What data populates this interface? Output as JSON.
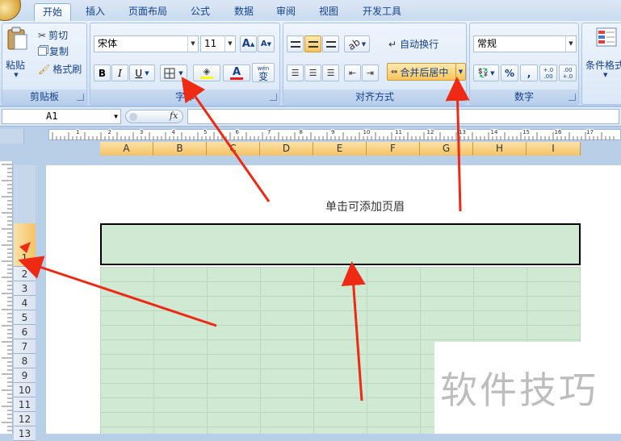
{
  "tabs": [
    {
      "label": "开始"
    },
    {
      "label": "插入"
    },
    {
      "label": "页面布局"
    },
    {
      "label": "公式"
    },
    {
      "label": "数据"
    },
    {
      "label": "审阅"
    },
    {
      "label": "视图"
    },
    {
      "label": "开发工具"
    }
  ],
  "clipboard": {
    "paste": "粘贴",
    "cut": "剪切",
    "copy": "复制",
    "format_painter": "格式刷",
    "label": "剪贴板"
  },
  "font": {
    "name": "宋体",
    "size": "11",
    "grow": "A",
    "shrink": "A",
    "bold": "B",
    "italic": "I",
    "underline": "U",
    "color_letter": "A",
    "phonetic": "wén",
    "phonetic_char": "变",
    "label": "字体"
  },
  "alignment": {
    "wrap": "自动换行",
    "merge": "合并后居中",
    "label": "对齐方式"
  },
  "number": {
    "format": "常规",
    "percent": "%",
    "comma": ",",
    "inc": "+.0 .00",
    "dec": ".00 +.0",
    "label": "数字"
  },
  "styles": {
    "conditional": "条件格式"
  },
  "formula_bar": {
    "cell_ref": "A1",
    "fx": "fx"
  },
  "ruler_numbers": [
    "1",
    "2",
    "3",
    "4",
    "5",
    "6",
    "7",
    "8",
    "9",
    "10",
    "11",
    "12",
    "13",
    "14",
    "15",
    "16",
    "17"
  ],
  "columns": [
    "A",
    "B",
    "C",
    "D",
    "E",
    "F",
    "G",
    "H",
    "I"
  ],
  "rows": [
    "1",
    "2",
    "3",
    "4",
    "5",
    "6",
    "7",
    "8",
    "9",
    "10",
    "11",
    "12",
    "13"
  ],
  "page": {
    "header_hint": "单击可添加页眉"
  },
  "watermark": "软件技巧",
  "colors": {
    "accent": "#f8c45c",
    "arrow": "#ee2a14",
    "cell_fill": "#d0e9d2"
  }
}
